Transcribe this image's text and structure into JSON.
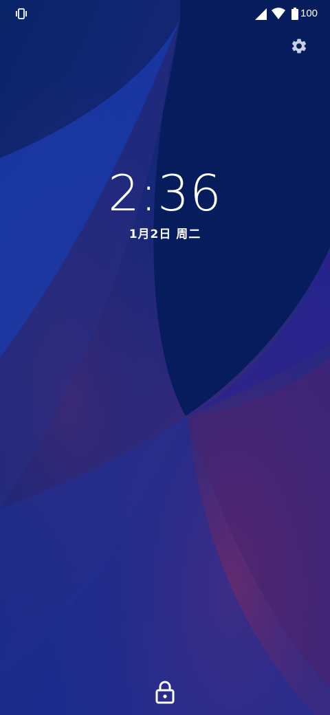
{
  "status_bar": {
    "ringer_icon": "vibrate-icon",
    "signal_icon": "cell-signal-icon",
    "wifi_icon": "wifi-icon",
    "battery_icon": "battery-icon",
    "battery_level": "100"
  },
  "lockscreen": {
    "time": "2:36",
    "date": "1月2日 周二",
    "settings_icon": "gear-icon",
    "lock_icon": "lock-icon"
  },
  "colors": {
    "background_top": "#07205f",
    "background_accent_blue": "#1f3aa6",
    "background_accent_purple": "#5a2a6e",
    "text": "#ffffff"
  }
}
